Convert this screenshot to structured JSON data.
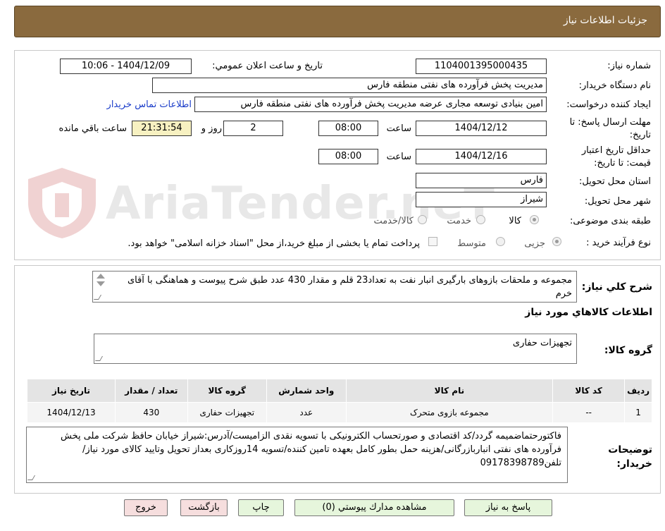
{
  "header": {
    "title": "جزئیات اطلاعات نیاز"
  },
  "watermark": {
    "text": "AriaTender.neT"
  },
  "form": {
    "need_number": {
      "label": "شماره نیاز:",
      "value": "1104001395000435"
    },
    "announce_datetime": {
      "label": "تاریخ و ساعت اعلان عمومي:",
      "value": "1404/12/09 - 10:06"
    },
    "buyer_org": {
      "label": "نام دستگاه خریدار:",
      "value": "مدیریت پخش فرآورده های نفتی منطقه فارس"
    },
    "requester": {
      "label": "ایجاد کننده درخواست:",
      "value": "امین بنیادی توسعه مجاری عرضه مدیریت پخش فرآورده های نفتی منطقه فارس",
      "contact_link": "اطلاعات تماس خریدار"
    },
    "reply_deadline": {
      "label_line1": "مهلت ارسال پاسخ: تا",
      "label_line2": "تاریخ:",
      "date": "1404/12/12",
      "time_label": "ساعت",
      "time": "08:00",
      "days": "2",
      "days_label": "روز و",
      "remaining": "21:31:54",
      "remaining_label": "ساعت باقي مانده"
    },
    "price_validity": {
      "label_line1": "حداقل تاریخ اعتبار",
      "label_line2": "قیمت: تا تاریخ:",
      "date": "1404/12/16",
      "time_label": "ساعت",
      "time": "08:00"
    },
    "province": {
      "label": "استان محل تحویل:",
      "value": "فارس"
    },
    "city": {
      "label": "شهر محل تحویل:",
      "value": "شیراز"
    },
    "category": {
      "label": "طبقه بندی موضوعی:",
      "options": [
        "کالا",
        "خدمت",
        "کالا/خدمت"
      ],
      "selected": "کالا"
    },
    "purchase_type": {
      "label": "نوع فرآیند خرید :",
      "options": [
        "جزیی",
        "متوسط"
      ],
      "selected": "جزیی",
      "payment_note": "پرداخت تمام یا بخشی از مبلغ خرید،از محل \"اسناد خزانه اسلامی\" خواهد بود."
    }
  },
  "description": {
    "label": "شرح کلي نیاز:",
    "text": "مجموعه و ملحقات بازوهای بارگیری انبار نفت به تعداد23 قلم و مقدار 430 عدد طبق شرح پیوست و هماهنگی با آقای خرم"
  },
  "goods_section": {
    "title": "اطلاعات کالاهاي مورد نیاز",
    "group_label": "گروه کالا:",
    "group_value": "تجهیزات حفاری",
    "table": {
      "headers": [
        "ردیف",
        "کد کالا",
        "نام کالا",
        "واحد شمارش",
        "گروه کالا",
        "تعداد / مقدار",
        "تاریخ نیاز"
      ],
      "rows": [
        [
          "1",
          "--",
          "مجموعه بازوی متحرک",
          "عدد",
          "تجهیزات حفاری",
          "430",
          "1404/12/13"
        ]
      ]
    },
    "notes_label": "توضیحات خریدار:",
    "notes_text": "فاکتورحتماضمیمه گردد/کد اقتصادی و صورتحساب الکترونیکی با تسویه نقدی الزامیست/آدرس:شیراز خیابان حافظ شرکت ملی پخش فرآورده های نفتی انباربازرگانی/هزینه حمل بطور کامل بعهده تامین کننده/تسویه 14روزکاری بعداز تحویل وتایید کالای مورد نیاز/تلفن09178398789"
  },
  "buttons": {
    "reply": "پاسخ به نیاز",
    "view_docs": "مشاهده مدارك پیوستي (0)",
    "print": "چاپ",
    "back": "بازگشت",
    "exit": "خروج"
  }
}
